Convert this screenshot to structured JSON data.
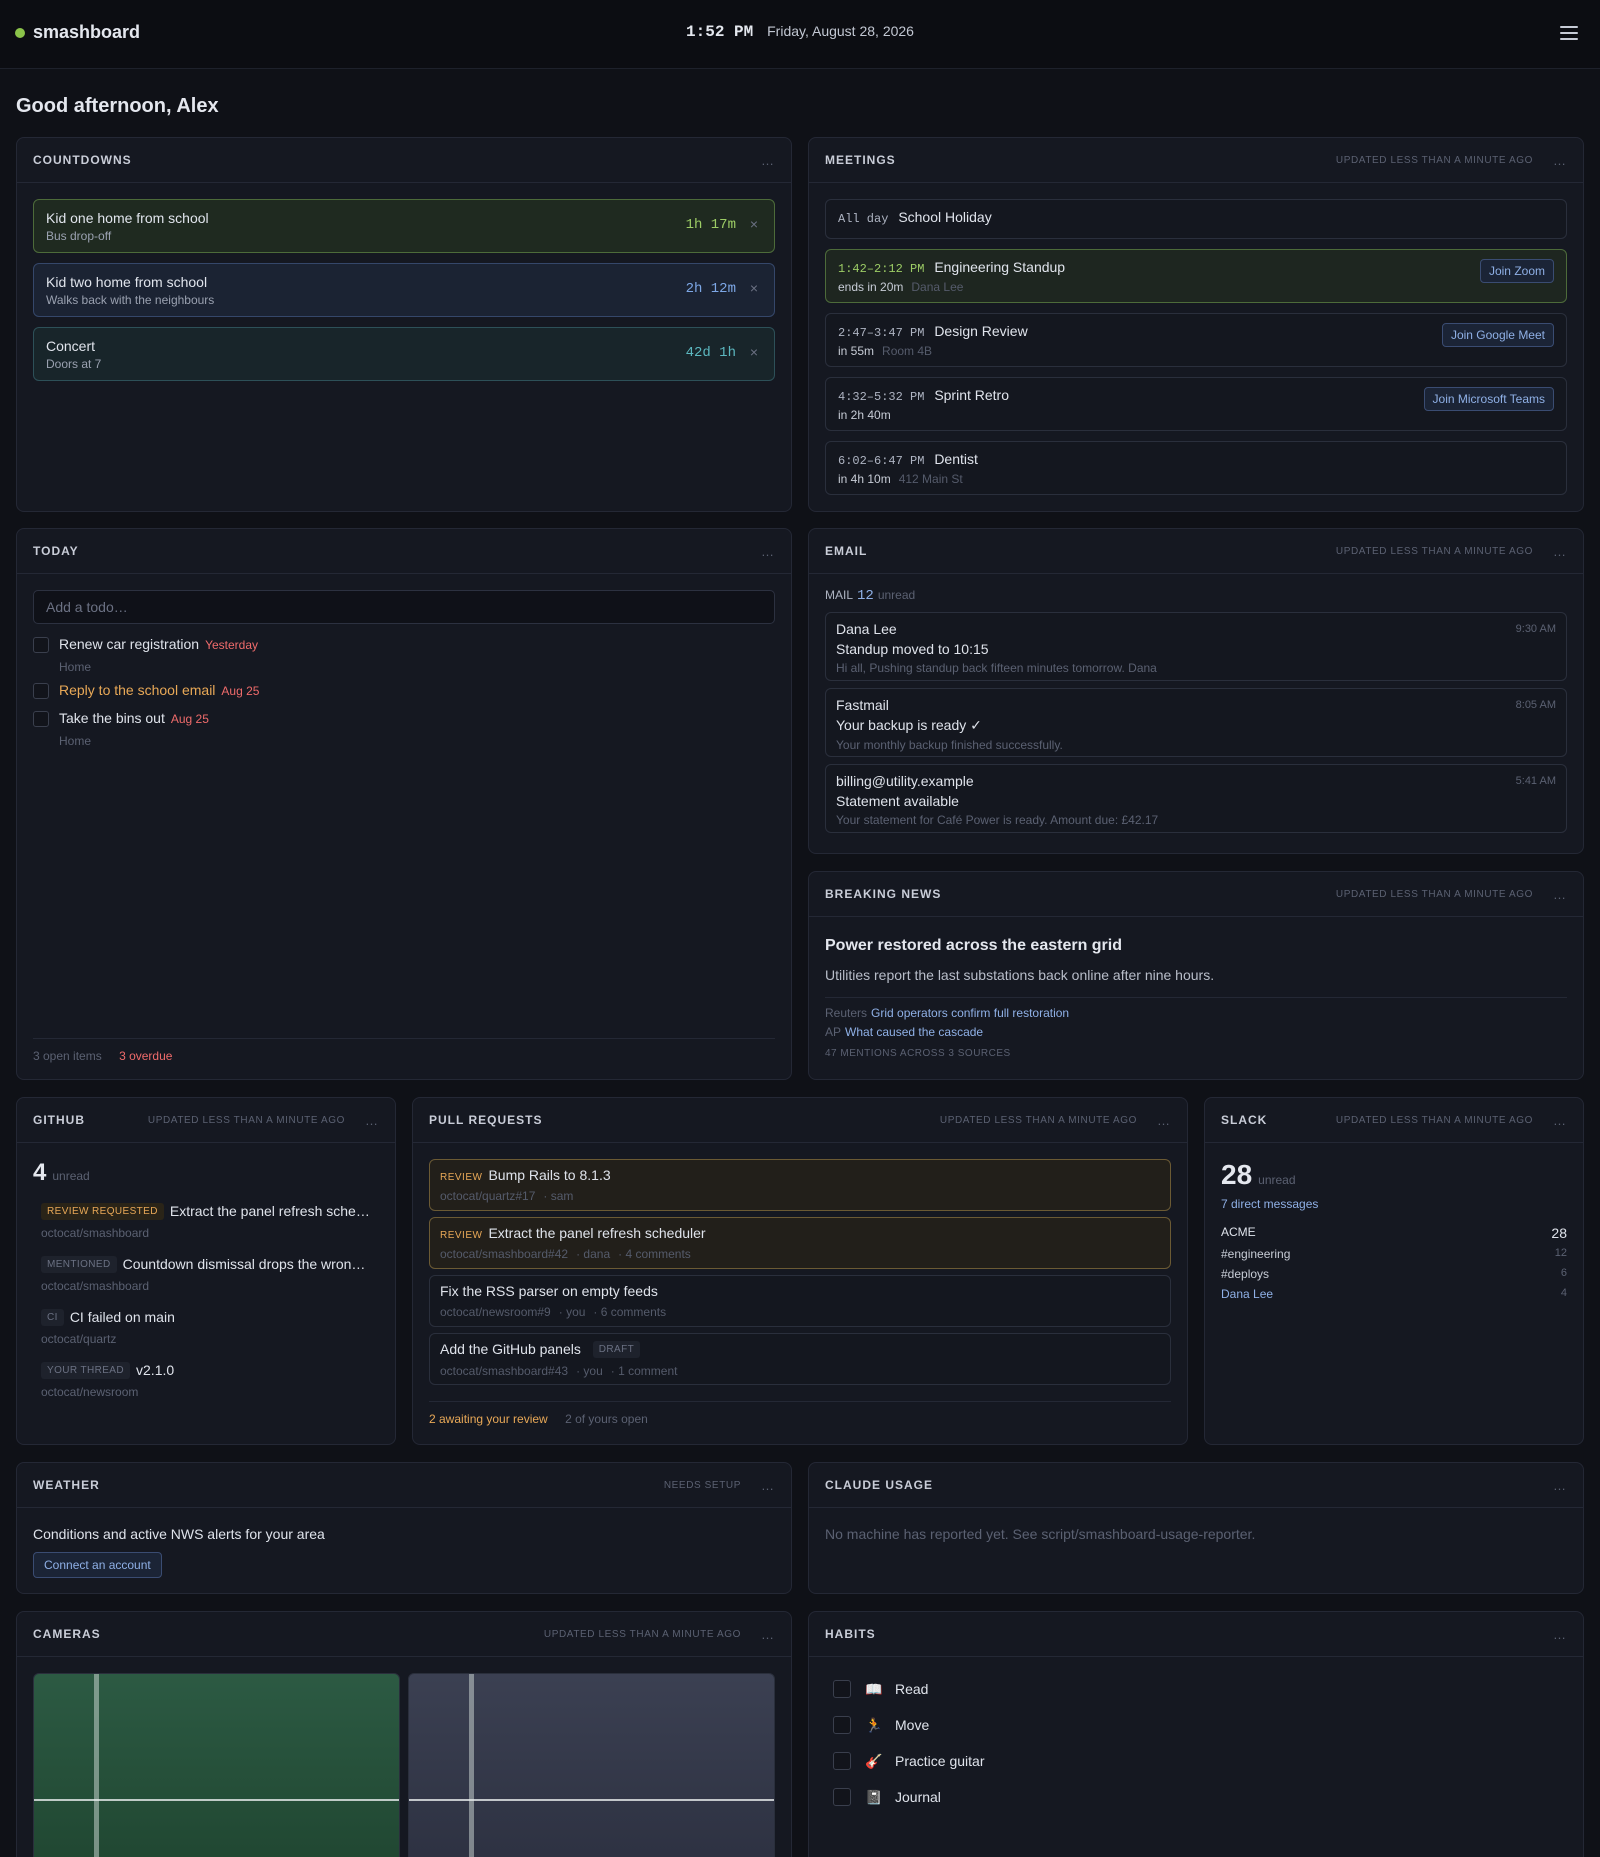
{
  "header": {
    "brand": "smashboard",
    "time": "1:52 PM",
    "date": "Friday, August 28, 2026"
  },
  "greeting": "Good afternoon, Alex",
  "updated": "UPDATED LESS THAN A MINUTE AGO",
  "more": "…",
  "countdowns": {
    "title": "COUNTDOWNS",
    "items": [
      {
        "label": "Kid one home from school",
        "sub": "Bus drop-off",
        "value": "1h 17m",
        "color": "#9ccc65"
      },
      {
        "label": "Kid two home from school",
        "sub": "Walks back with the neighbours",
        "value": "2h 12m",
        "color": "#7da7e6"
      },
      {
        "label": "Concert",
        "sub": "Doors at 7",
        "value": "42d 1h",
        "color": "#5cb8c0"
      }
    ],
    "dismiss": "×"
  },
  "meetings": {
    "title": "MEETINGS",
    "items": [
      {
        "time": "All day",
        "title": "School Holiday"
      },
      {
        "time": "1:42–2:12 PM",
        "title": "Engineering Standup",
        "sub": "ends in 20m",
        "loc": "Dana Lee",
        "join": "Join Zoom"
      },
      {
        "time": "2:47–3:47 PM",
        "title": "Design Review",
        "sub": "in 55m",
        "loc": "Room 4B",
        "join": "Join Google Meet"
      },
      {
        "time": "4:32–5:32 PM",
        "title": "Sprint Retro",
        "sub": "in 2h 40m",
        "join": "Join Microsoft Teams"
      },
      {
        "time": "6:02–6:47 PM",
        "title": "Dentist",
        "sub": "in 4h 10m",
        "loc": "412 Main St"
      }
    ]
  },
  "today": {
    "title": "TODAY",
    "placeholder": "Add a todo…",
    "items": [
      {
        "text": "Renew car registration",
        "due": "Yesterday",
        "cat": "Home"
      },
      {
        "text": "Reply to the school email",
        "due": "Aug 25"
      },
      {
        "text": "Take the bins out",
        "due": "Aug 25",
        "cat": "Home"
      }
    ],
    "open": "3 open items",
    "overdue": "3 overdue"
  },
  "email": {
    "title": "EMAIL",
    "label": "MAIL",
    "count": "12",
    "unread": "unread",
    "items": [
      {
        "from": "Dana Lee",
        "time": "9:30 AM",
        "subject": "Standup moved to 10:15",
        "preview": "Hi all, Pushing standup back fifteen minutes tomorrow. Dana"
      },
      {
        "from": "Fastmail",
        "time": "8:05 AM",
        "subject": "Your backup is ready ✓",
        "preview": "Your monthly backup finished successfully."
      },
      {
        "from": "billing@utility.example",
        "time": "5:41 AM",
        "subject": "Statement available",
        "preview": "Your statement for Café Power is ready. Amount due: £42.17"
      }
    ]
  },
  "news": {
    "title": "BREAKING NEWS",
    "headline": "Power restored across the eastern grid",
    "desc": "Utilities report the last substations back online after nine hours.",
    "links": [
      {
        "src": "Reuters",
        "text": "Grid operators confirm full restoration"
      },
      {
        "src": "AP",
        "text": "What caused the cascade"
      }
    ],
    "meta": "47 MENTIONS ACROSS 3 SOURCES"
  },
  "github": {
    "title": "GITHUB",
    "count": "4",
    "unread": "unread",
    "items": [
      {
        "tag": "REVIEW REQUESTED",
        "text": "Extract the panel refresh sche…",
        "repo": "octocat/smashboard"
      },
      {
        "tag": "MENTIONED",
        "text": "Countdown dismissal drops the wron…",
        "repo": "octocat/smashboard"
      },
      {
        "tag": "CI",
        "text": "CI failed on main",
        "repo": "octocat/quartz"
      },
      {
        "tag": "YOUR THREAD",
        "text": "v2.1.0",
        "repo": "octocat/newsroom"
      }
    ]
  },
  "prs": {
    "title": "PULL REQUESTS",
    "items": [
      {
        "tag": "REVIEW",
        "title": "Bump Rails to 8.1.3",
        "repo": "octocat/quartz#17",
        "who": "· sam"
      },
      {
        "tag": "REVIEW",
        "title": "Extract the panel refresh scheduler",
        "repo": "octocat/smashboard#42",
        "who": "· dana",
        "comments": "· 4 comments"
      },
      {
        "title": "Fix the RSS parser on empty feeds",
        "repo": "octocat/newsroom#9",
        "who": "· you",
        "comments": "· 6 comments"
      },
      {
        "title": "Add the GitHub panels",
        "draft": "DRAFT",
        "repo": "octocat/smashboard#43",
        "who": "· you",
        "comments": "· 1 comment"
      }
    ],
    "awaiting": "2 awaiting your review",
    "mine": "2 of yours open"
  },
  "slack": {
    "title": "SLACK",
    "count": "28",
    "unread": "unread",
    "dms": "7 direct messages",
    "workspace": "ACME",
    "workspace_count": "28",
    "channels": [
      {
        "name": "#engineering",
        "n": "12"
      },
      {
        "name": "#deploys",
        "n": "6"
      },
      {
        "name": "Dana Lee",
        "n": "4"
      }
    ]
  },
  "weather": {
    "title": "WEATHER",
    "status": "NEEDS SETUP",
    "desc": "Conditions and active NWS alerts for your area",
    "button": "Connect an account"
  },
  "claude": {
    "title": "CLAUDE USAGE",
    "desc": "No machine has reported yet. See script/smashboard-usage-reporter."
  },
  "cameras": {
    "title": "CAMERAS"
  },
  "habits": {
    "title": "HABITS",
    "items": [
      {
        "icon": "📖",
        "name": "Read"
      },
      {
        "icon": "🏃",
        "name": "Move"
      },
      {
        "icon": "🎸",
        "name": "Practice guitar"
      },
      {
        "icon": "📓",
        "name": "Journal"
      }
    ]
  }
}
